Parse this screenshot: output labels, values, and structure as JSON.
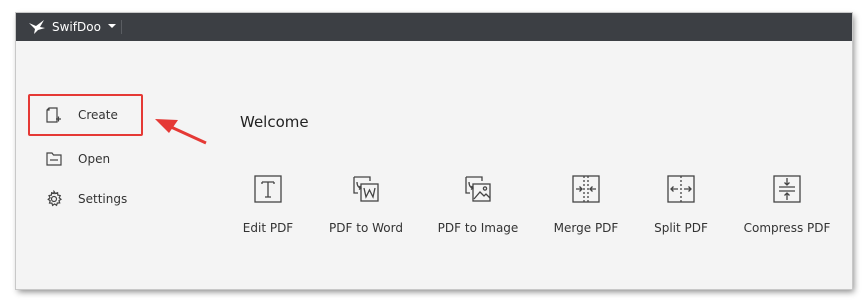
{
  "app": {
    "title": "SwifDoo"
  },
  "sidebar": {
    "items": [
      {
        "label": "Create",
        "icon": "new-file-icon"
      },
      {
        "label": "Open",
        "icon": "folder-open-icon"
      },
      {
        "label": "Settings",
        "icon": "gear-icon"
      }
    ]
  },
  "main": {
    "heading": "Welcome",
    "tools": [
      {
        "label": "Edit PDF",
        "icon": "edit-text-icon"
      },
      {
        "label": "PDF to Word",
        "icon": "pdf-to-word-icon"
      },
      {
        "label": "PDF to Image",
        "icon": "pdf-to-image-icon"
      },
      {
        "label": "Merge PDF",
        "icon": "merge-icon"
      },
      {
        "label": "Split PDF",
        "icon": "split-icon"
      },
      {
        "label": "Compress PDF",
        "icon": "compress-icon"
      }
    ]
  },
  "annotation": {
    "color": "#e53935"
  },
  "colors": {
    "titlebar": "#3c3f44",
    "background": "#f4f4f4",
    "accent": "#e53935"
  }
}
